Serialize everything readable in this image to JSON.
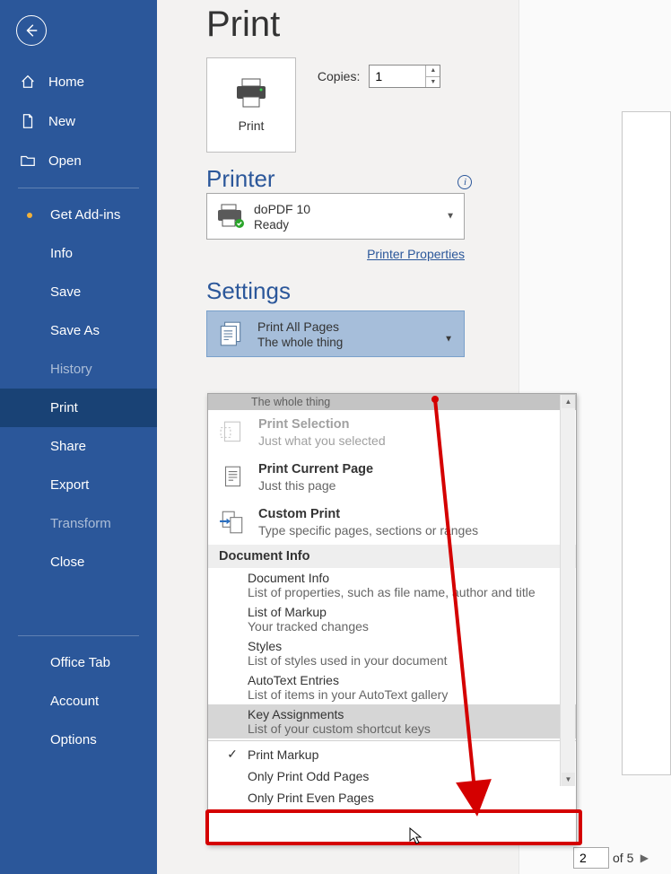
{
  "sidebar": {
    "items": [
      {
        "label": "Home"
      },
      {
        "label": "New"
      },
      {
        "label": "Open"
      },
      {
        "label": "Get Add-ins"
      },
      {
        "label": "Info"
      },
      {
        "label": "Save"
      },
      {
        "label": "Save As"
      },
      {
        "label": "History"
      },
      {
        "label": "Print"
      },
      {
        "label": "Share"
      },
      {
        "label": "Export"
      },
      {
        "label": "Transform"
      },
      {
        "label": "Close"
      },
      {
        "label": "Office Tab"
      },
      {
        "label": "Account"
      },
      {
        "label": "Options"
      }
    ]
  },
  "page": {
    "title": "Print",
    "print_button": "Print",
    "copies_label": "Copies:",
    "copies_value": "1",
    "printer_heading": "Printer",
    "printer_name": "doPDF 10",
    "printer_status": "Ready",
    "printer_properties": "Printer Properties",
    "settings_heading": "Settings",
    "settings_selected_title": "Print All Pages",
    "settings_selected_sub": "The whole thing"
  },
  "dropdown": {
    "top_cut": "The whole thing",
    "options": [
      {
        "title": "Print Selection",
        "sub": "Just what you selected",
        "disabled": true
      },
      {
        "title": "Print Current Page",
        "sub": "Just this page"
      },
      {
        "title": "Custom Print",
        "sub": "Type specific pages, sections or ranges"
      }
    ],
    "doc_info_header": "Document Info",
    "doc_info": [
      {
        "title": "Document Info",
        "sub": "List of properties, such as file name, author and title"
      },
      {
        "title": "List of Markup",
        "sub": "Your tracked changes"
      },
      {
        "title": "Styles",
        "sub": "List of styles used in your document"
      },
      {
        "title": "AutoText Entries",
        "sub": "List of items in your AutoText gallery"
      },
      {
        "title": "Key Assignments",
        "sub": "List of your custom shortcut keys"
      }
    ],
    "checks": [
      {
        "label": "Print Markup",
        "checked": true
      },
      {
        "label": "Only Print Odd Pages",
        "checked": false
      },
      {
        "label": "Only Print Even Pages",
        "checked": false
      }
    ]
  },
  "pager": {
    "current": "2",
    "total": "of 5"
  }
}
